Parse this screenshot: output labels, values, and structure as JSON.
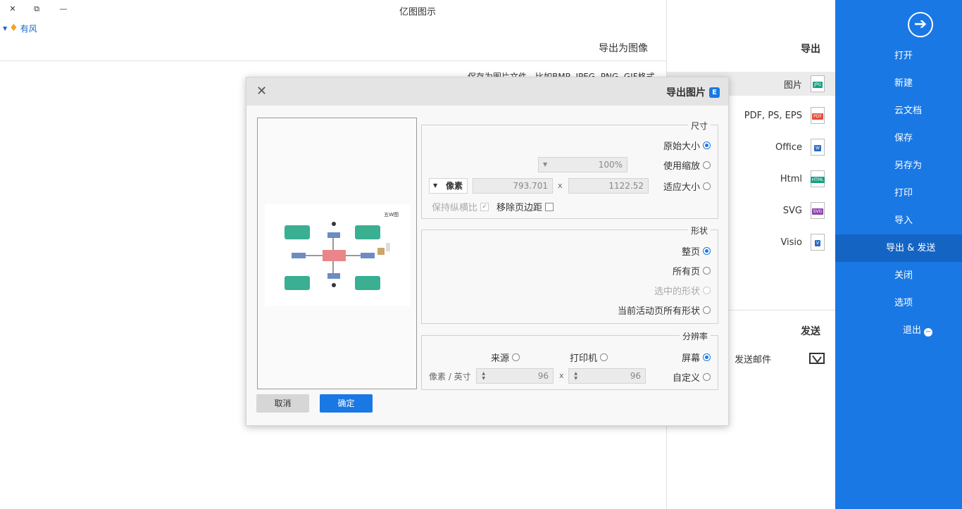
{
  "window": {
    "title": "亿图图示",
    "user_name": "有风",
    "close_glyph": "✕",
    "restore_glyph": "⧉",
    "minimize_glyph": "—"
  },
  "export_page": {
    "title": "导出为图像",
    "description": "保存为图片文件，比如BMP, JPEG, PNG, GIF格式"
  },
  "format_panel": {
    "export_heading": "导出",
    "items": [
      {
        "label": "图片",
        "tag": "JPG",
        "color": "#16a085"
      },
      {
        "label": "PDF, PS, EPS",
        "tag": "PDF",
        "color": "#e74c3c"
      },
      {
        "label": "Office",
        "tag": "W",
        "color": "#2b6cc4"
      },
      {
        "label": "Html",
        "tag": "HTML",
        "color": "#16a085"
      },
      {
        "label": "SVG",
        "tag": "SVG",
        "color": "#8e44ad"
      },
      {
        "label": "Visio",
        "tag": "V",
        "color": "#2b6cc4"
      }
    ],
    "send_heading": "发送",
    "send_email": "发送邮件"
  },
  "sidebar": {
    "items": [
      "打开",
      "新建",
      "云文档",
      "保存",
      "另存为",
      "打印",
      "导入",
      "导出 & 发送",
      "关闭",
      "选项",
      "退出"
    ],
    "active_index": 7
  },
  "dialog": {
    "title": "导出图片",
    "logo_letter": "E",
    "close_glyph": "✕",
    "size_section": {
      "legend": "尺寸",
      "original": "原始大小",
      "use_zoom": "使用缩放",
      "zoom_value": "100%",
      "fit_size": "适应大小",
      "width": "1122.52",
      "height": "793.701",
      "unit": "像素",
      "remove_margin": "移除页边距",
      "keep_ratio": "保持纵横比",
      "selected": "original"
    },
    "shape_section": {
      "legend": "形状",
      "whole_page": "整页",
      "all_pages": "所有页",
      "selected_shapes": "选中的形状",
      "current_active_page": "当前活动页所有形状",
      "selected": "whole_page"
    },
    "resolution_section": {
      "legend": "分辨率",
      "screen": "屏幕",
      "printer": "打印机",
      "source": "来源",
      "custom": "自定义",
      "dpi_x": "96",
      "dpi_y": "96",
      "unit": "像素 / 英寸",
      "selected": "screen"
    },
    "ok": "确定",
    "cancel": "取消",
    "preview_label": "五W图"
  }
}
